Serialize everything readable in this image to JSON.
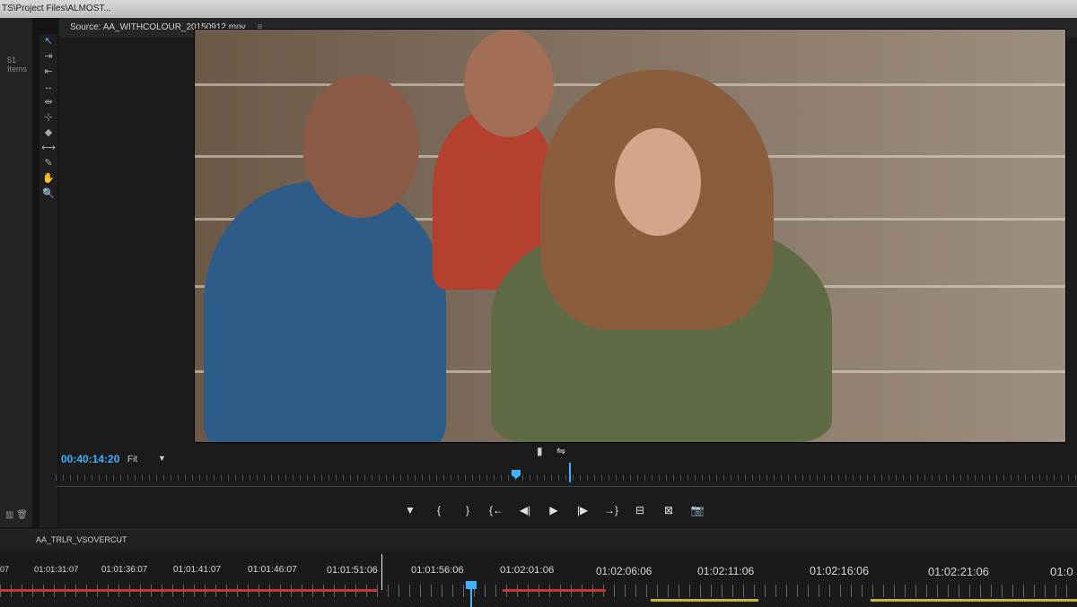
{
  "app": {
    "title_path": "TS\\Project Files\\ALMOST..."
  },
  "project": {
    "items_count": "51 Items"
  },
  "source_monitor": {
    "tab_label": "Source: AA_WITHCOLOUR_20150912.mov",
    "menu_glyph": "≡",
    "timecode": "00:40:14:20",
    "fit_label": "Fit",
    "fit_arrow": "▼",
    "mini_icons": [
      "▮",
      "⇋"
    ]
  },
  "tools": [
    {
      "icon": "selection-tool-icon",
      "glyph": "↖"
    },
    {
      "icon": "track-select-icon",
      "glyph": "⇥"
    },
    {
      "icon": "ripple-edit-icon",
      "glyph": "⇤"
    },
    {
      "icon": "rolling-edit-icon",
      "glyph": "↔"
    },
    {
      "icon": "rate-stretch-icon",
      "glyph": "⇹"
    },
    {
      "icon": "razor-tool-icon",
      "glyph": "⊹"
    },
    {
      "icon": "slip-tool-icon",
      "glyph": "◆"
    },
    {
      "icon": "slide-tool-icon",
      "glyph": "⟷"
    },
    {
      "icon": "pen-tool-icon",
      "glyph": "✎"
    },
    {
      "icon": "hand-tool-icon",
      "glyph": "✋"
    },
    {
      "icon": "zoom-tool-icon",
      "glyph": "🔍"
    }
  ],
  "transport": [
    {
      "name": "add-marker-button",
      "glyph": "▼"
    },
    {
      "name": "mark-in-button",
      "glyph": "{"
    },
    {
      "name": "mark-out-button",
      "glyph": "}"
    },
    {
      "name": "go-to-in-button",
      "glyph": "{←"
    },
    {
      "name": "step-back-button",
      "glyph": "◀|"
    },
    {
      "name": "play-button",
      "glyph": "▶"
    },
    {
      "name": "step-forward-button",
      "glyph": "|▶"
    },
    {
      "name": "go-to-out-button",
      "glyph": "→}"
    },
    {
      "name": "insert-button",
      "glyph": "⊟"
    },
    {
      "name": "overwrite-button",
      "glyph": "⊠"
    },
    {
      "name": "export-frame-button",
      "glyph": "📷"
    }
  ],
  "sequence": {
    "tab_label": "AA_TRLR_VSOVERCUT",
    "timecodes": [
      "07",
      "01:01:31:07",
      "01:01:36:07",
      "01:01:41:07",
      "01:01:46:07",
      "01:01:51:06",
      "01:01:56:06",
      "01:02:01:06",
      "01:02:06:06",
      "01:02:11:06",
      "01:02:16:06",
      "01:02:21:06",
      "01:0"
    ]
  },
  "colors": {
    "accent": "#3fb2ff",
    "work_area_red": "#cc3333",
    "work_area_yellow": "#c8b52a"
  }
}
